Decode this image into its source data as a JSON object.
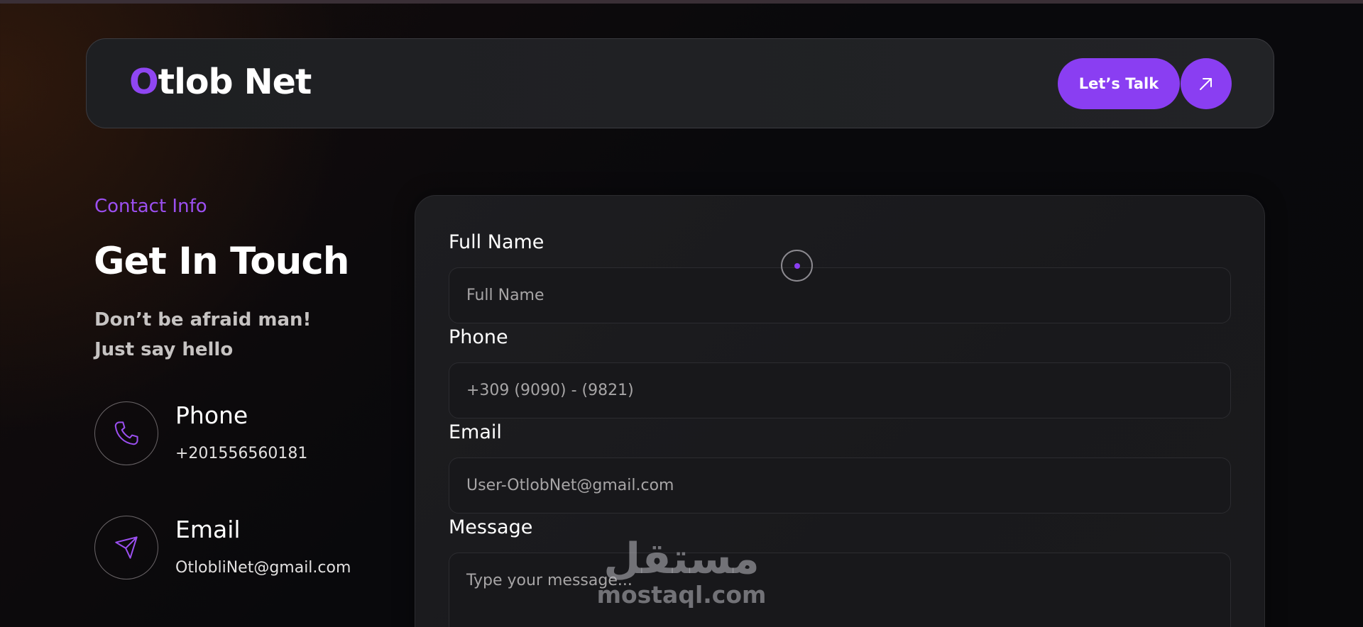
{
  "header": {
    "logo_first": "O",
    "logo_rest": "tlob Net",
    "cta_label": "Let’s Talk",
    "cta_icon": "arrow-up-right-icon"
  },
  "contact": {
    "eyebrow": "Contact Info",
    "title": "Get In Touch",
    "subtitle": "Don’t be afraid man! Just say hello",
    "items": [
      {
        "label": "Phone",
        "value": "+201556560181",
        "icon": "phone-icon"
      },
      {
        "label": "Email",
        "value": "OtlobliNet@gmail.com",
        "icon": "send-icon"
      }
    ]
  },
  "form": {
    "full_name": {
      "label": "Full Name",
      "placeholder": "Full Name"
    },
    "phone": {
      "label": "Phone",
      "placeholder": "+309 (9090) - (9821)"
    },
    "email": {
      "label": "Email",
      "placeholder": "User-OtlobNet@gmail.com"
    },
    "message": {
      "label": "Message",
      "placeholder": "Type your message..."
    }
  },
  "watermark": {
    "arabic": "مستقل",
    "latin": "mostaql.com"
  },
  "colors": {
    "accent": "#8a3ef2",
    "background": "#0a0a0c",
    "card": "#1c1c1f"
  }
}
